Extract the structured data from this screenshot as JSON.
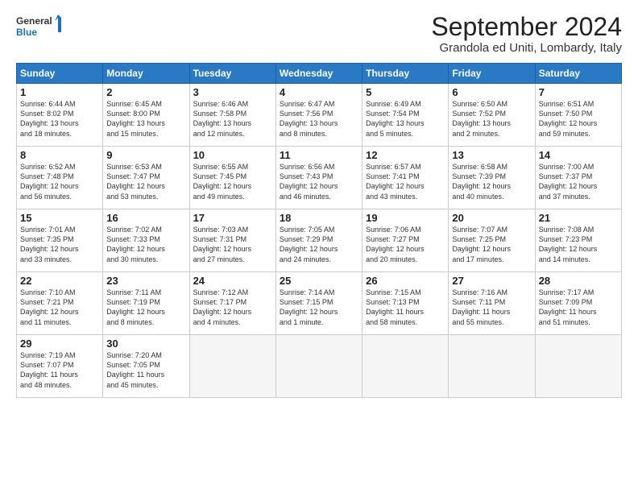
{
  "header": {
    "logo_line1": "General",
    "logo_line2": "Blue",
    "month": "September 2024",
    "location": "Grandola ed Uniti, Lombardy, Italy"
  },
  "weekdays": [
    "Sunday",
    "Monday",
    "Tuesday",
    "Wednesday",
    "Thursday",
    "Friday",
    "Saturday"
  ],
  "weeks": [
    [
      {
        "day": "1",
        "info": "Sunrise: 6:44 AM\nSunset: 8:02 PM\nDaylight: 13 hours\nand 18 minutes."
      },
      {
        "day": "2",
        "info": "Sunrise: 6:45 AM\nSunset: 8:00 PM\nDaylight: 13 hours\nand 15 minutes."
      },
      {
        "day": "3",
        "info": "Sunrise: 6:46 AM\nSunset: 7:58 PM\nDaylight: 13 hours\nand 12 minutes."
      },
      {
        "day": "4",
        "info": "Sunrise: 6:47 AM\nSunset: 7:56 PM\nDaylight: 13 hours\nand 8 minutes."
      },
      {
        "day": "5",
        "info": "Sunrise: 6:49 AM\nSunset: 7:54 PM\nDaylight: 13 hours\nand 5 minutes."
      },
      {
        "day": "6",
        "info": "Sunrise: 6:50 AM\nSunset: 7:52 PM\nDaylight: 13 hours\nand 2 minutes."
      },
      {
        "day": "7",
        "info": "Sunrise: 6:51 AM\nSunset: 7:50 PM\nDaylight: 12 hours\nand 59 minutes."
      }
    ],
    [
      {
        "day": "8",
        "info": "Sunrise: 6:52 AM\nSunset: 7:48 PM\nDaylight: 12 hours\nand 56 minutes."
      },
      {
        "day": "9",
        "info": "Sunrise: 6:53 AM\nSunset: 7:47 PM\nDaylight: 12 hours\nand 53 minutes."
      },
      {
        "day": "10",
        "info": "Sunrise: 6:55 AM\nSunset: 7:45 PM\nDaylight: 12 hours\nand 49 minutes."
      },
      {
        "day": "11",
        "info": "Sunrise: 6:56 AM\nSunset: 7:43 PM\nDaylight: 12 hours\nand 46 minutes."
      },
      {
        "day": "12",
        "info": "Sunrise: 6:57 AM\nSunset: 7:41 PM\nDaylight: 12 hours\nand 43 minutes."
      },
      {
        "day": "13",
        "info": "Sunrise: 6:58 AM\nSunset: 7:39 PM\nDaylight: 12 hours\nand 40 minutes."
      },
      {
        "day": "14",
        "info": "Sunrise: 7:00 AM\nSunset: 7:37 PM\nDaylight: 12 hours\nand 37 minutes."
      }
    ],
    [
      {
        "day": "15",
        "info": "Sunrise: 7:01 AM\nSunset: 7:35 PM\nDaylight: 12 hours\nand 33 minutes."
      },
      {
        "day": "16",
        "info": "Sunrise: 7:02 AM\nSunset: 7:33 PM\nDaylight: 12 hours\nand 30 minutes."
      },
      {
        "day": "17",
        "info": "Sunrise: 7:03 AM\nSunset: 7:31 PM\nDaylight: 12 hours\nand 27 minutes."
      },
      {
        "day": "18",
        "info": "Sunrise: 7:05 AM\nSunset: 7:29 PM\nDaylight: 12 hours\nand 24 minutes."
      },
      {
        "day": "19",
        "info": "Sunrise: 7:06 AM\nSunset: 7:27 PM\nDaylight: 12 hours\nand 20 minutes."
      },
      {
        "day": "20",
        "info": "Sunrise: 7:07 AM\nSunset: 7:25 PM\nDaylight: 12 hours\nand 17 minutes."
      },
      {
        "day": "21",
        "info": "Sunrise: 7:08 AM\nSunset: 7:23 PM\nDaylight: 12 hours\nand 14 minutes."
      }
    ],
    [
      {
        "day": "22",
        "info": "Sunrise: 7:10 AM\nSunset: 7:21 PM\nDaylight: 12 hours\nand 11 minutes."
      },
      {
        "day": "23",
        "info": "Sunrise: 7:11 AM\nSunset: 7:19 PM\nDaylight: 12 hours\nand 8 minutes."
      },
      {
        "day": "24",
        "info": "Sunrise: 7:12 AM\nSunset: 7:17 PM\nDaylight: 12 hours\nand 4 minutes."
      },
      {
        "day": "25",
        "info": "Sunrise: 7:14 AM\nSunset: 7:15 PM\nDaylight: 12 hours\nand 1 minute."
      },
      {
        "day": "26",
        "info": "Sunrise: 7:15 AM\nSunset: 7:13 PM\nDaylight: 11 hours\nand 58 minutes."
      },
      {
        "day": "27",
        "info": "Sunrise: 7:16 AM\nSunset: 7:11 PM\nDaylight: 11 hours\nand 55 minutes."
      },
      {
        "day": "28",
        "info": "Sunrise: 7:17 AM\nSunset: 7:09 PM\nDaylight: 11 hours\nand 51 minutes."
      }
    ],
    [
      {
        "day": "29",
        "info": "Sunrise: 7:19 AM\nSunset: 7:07 PM\nDaylight: 11 hours\nand 48 minutes."
      },
      {
        "day": "30",
        "info": "Sunrise: 7:20 AM\nSunset: 7:05 PM\nDaylight: 11 hours\nand 45 minutes."
      },
      {
        "day": "",
        "info": ""
      },
      {
        "day": "",
        "info": ""
      },
      {
        "day": "",
        "info": ""
      },
      {
        "day": "",
        "info": ""
      },
      {
        "day": "",
        "info": ""
      }
    ]
  ]
}
